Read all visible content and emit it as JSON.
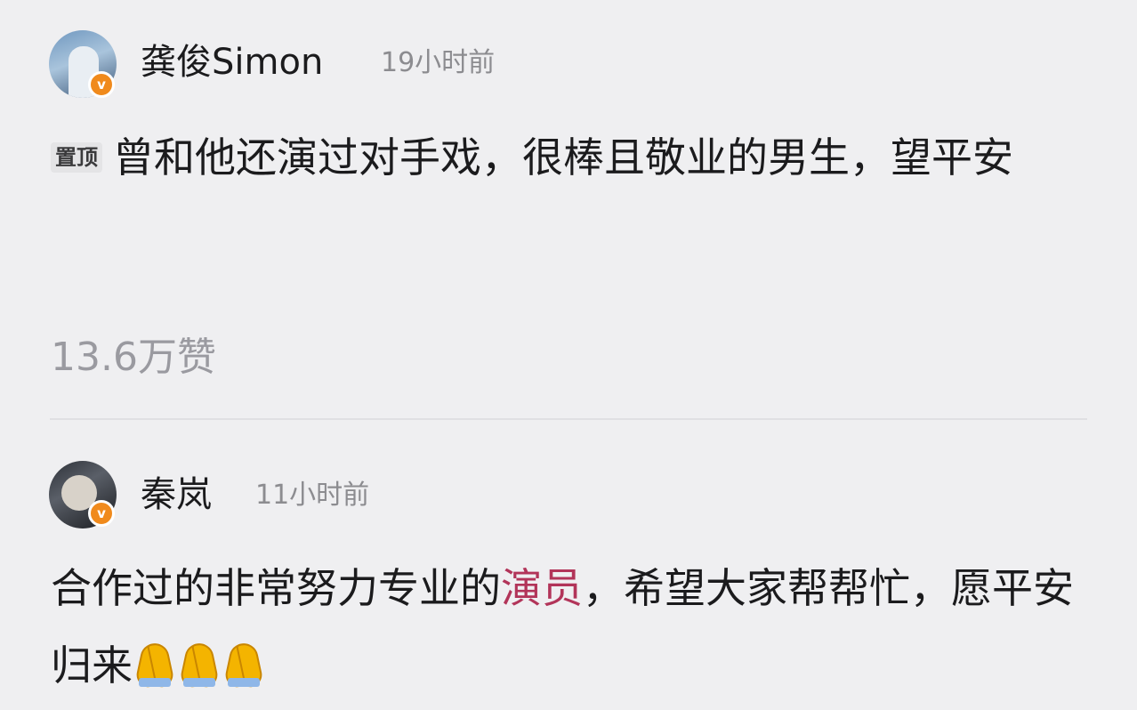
{
  "comments": [
    {
      "username": "龚俊Simon",
      "time": "19小时前",
      "pinned_label": "置顶",
      "text": "曾和他还演过对手戏，很棒且敬业的男生，望平安",
      "likes": "13.6万赞",
      "badge_glyph": "v",
      "avatar_icon": "user-avatar-icon"
    },
    {
      "username": "秦岚",
      "time": "11小时前",
      "text_before": "合作过的非常努力专业的",
      "text_highlight": "演员",
      "text_after": "，希望大家帮帮忙，愿平安归来",
      "emoji": [
        "folded-hands-icon",
        "folded-hands-icon",
        "folded-hands-icon"
      ],
      "badge_glyph": "v",
      "avatar_icon": "user-avatar-icon"
    }
  ],
  "colors": {
    "background": "#efeff1",
    "text": "#1b1b1d",
    "muted": "#8c8c90",
    "highlight": "#b23459",
    "badge": "#f08a1c"
  }
}
